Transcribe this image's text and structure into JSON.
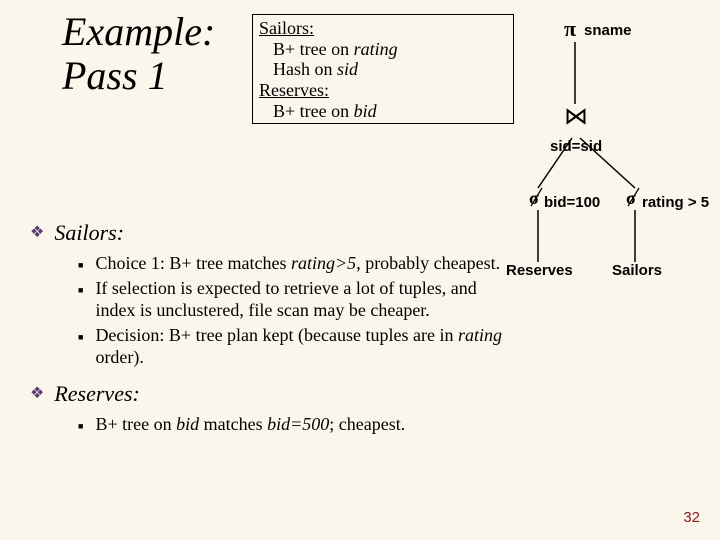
{
  "title_line1": "Example:",
  "title_line2": "Pass 1",
  "indexes": {
    "sailors_hd": "Sailors:",
    "sailors_1a": "B+ tree on ",
    "sailors_1b": "rating",
    "sailors_2a": "Hash on ",
    "sailors_2b": "sid",
    "reserves_hd": "Reserves:",
    "reserves_1a": "B+ tree on ",
    "reserves_1b": "bid"
  },
  "sections": {
    "sailors_head": "Sailors:",
    "reserves_head": "Reserves:"
  },
  "sailors_bullets": {
    "c1a": "Choice 1: B+ tree matches ",
    "c1b": "rating>5",
    "c1c": ", probably cheapest.",
    "c2": "If selection is expected to retrieve a lot of tuples, and index is unclustered, file scan may be cheaper.",
    "c3a": "Decision: B+ tree plan kept (because tuples are in ",
    "c3b": "rating",
    "c3c": " order)."
  },
  "reserves_bullets": {
    "r1a": "B+ tree on ",
    "r1b": "bid",
    "r1c": " matches ",
    "r1d": "bid=500",
    "r1e": "; cheapest."
  },
  "tree": {
    "pi": "π",
    "sname": "sname",
    "join": "⋈",
    "sidsid": "sid=sid",
    "sigma": "σ",
    "bid100": "bid=100",
    "rating5": "rating > 5",
    "reserves": "Reserves",
    "sailors": "Sailors"
  },
  "page": "32"
}
